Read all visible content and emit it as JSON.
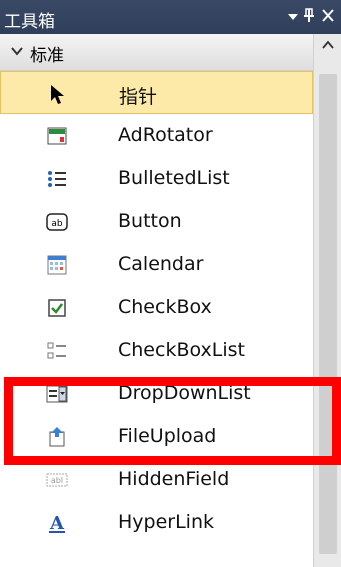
{
  "window": {
    "title": "工具箱",
    "controls": {
      "dropdown": "▼",
      "pin": "I",
      "close": "✕"
    }
  },
  "category": {
    "chevron": "v",
    "label": "标准"
  },
  "items": [
    {
      "label": "指针",
      "icon": "pointer-icon",
      "selected": true
    },
    {
      "label": "AdRotator",
      "icon": "adrotator-icon"
    },
    {
      "label": "BulletedList",
      "icon": "bulleted-list-icon"
    },
    {
      "label": "Button",
      "icon": "button-icon"
    },
    {
      "label": "Calendar",
      "icon": "calendar-icon"
    },
    {
      "label": "CheckBox",
      "icon": "checkbox-icon"
    },
    {
      "label": "CheckBoxList",
      "icon": "checkbox-list-icon"
    },
    {
      "label": "DropDownList",
      "icon": "dropdown-list-icon",
      "highlighted": true
    },
    {
      "label": "FileUpload",
      "icon": "file-upload-icon"
    },
    {
      "label": "HiddenField",
      "icon": "hidden-field-icon"
    },
    {
      "label": "HyperLink",
      "icon": "hyperlink-icon"
    }
  ],
  "colors": {
    "selected_bg": "#fdeaa8",
    "highlight_border": "#ff0000",
    "title_bg": "#34445f"
  }
}
